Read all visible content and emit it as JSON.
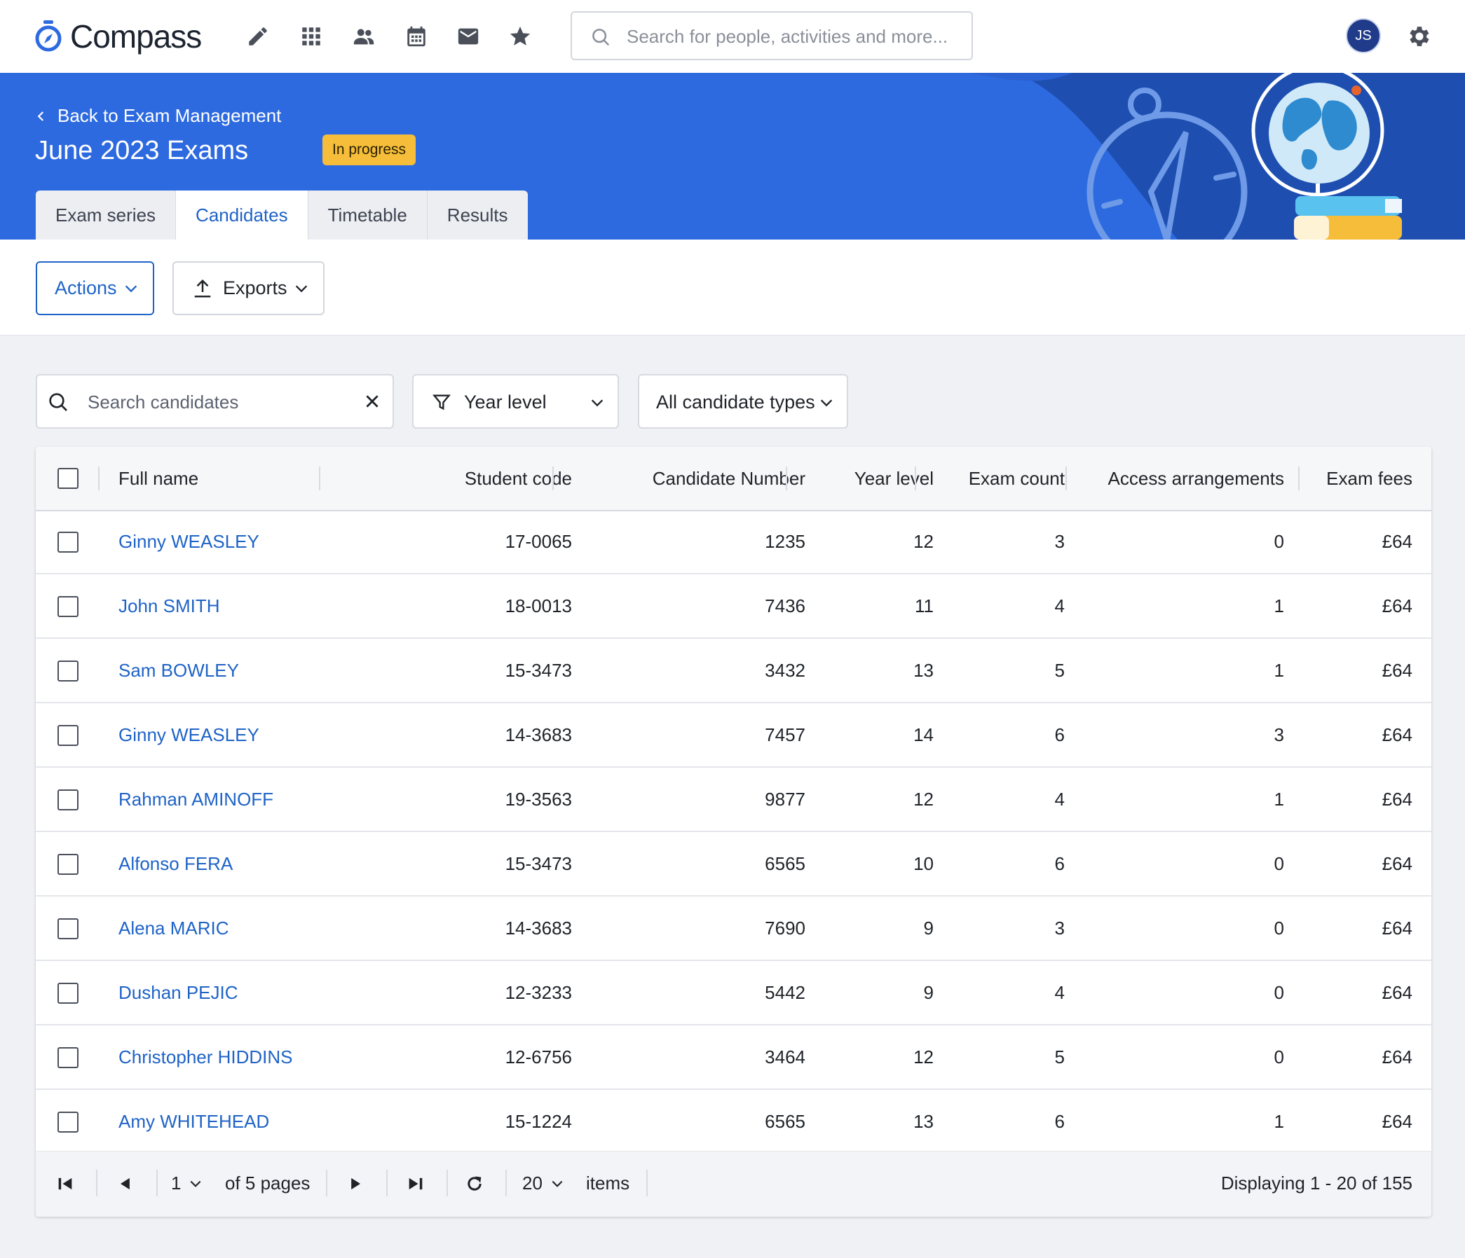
{
  "app": {
    "name": "Compass"
  },
  "top_nav": {
    "icons": [
      "pencil-icon",
      "apps-grid-icon",
      "people-icon",
      "calendar-icon",
      "mail-icon",
      "star-icon"
    ],
    "search_placeholder": "Search for people, activities and more...",
    "user_initials": "JS"
  },
  "header": {
    "back_label": "Back to Exam Management",
    "title": "June 2023 Exams",
    "status": "In progress",
    "tabs": [
      "Exam series",
      "Candidates",
      "Timetable",
      "Results"
    ],
    "active_tab": "Candidates"
  },
  "toolbar": {
    "actions_label": "Actions",
    "exports_label": "Exports"
  },
  "filters": {
    "search_placeholder": "Search candidates",
    "year_level_label": "Year level",
    "candidate_types_label": "All candidate types"
  },
  "table": {
    "columns": [
      "Full name",
      "Student code",
      "Candidate Number",
      "Year level",
      "Exam count",
      "Access arrangements",
      "Exam fees"
    ],
    "rows": [
      {
        "name": "Ginny WEASLEY",
        "code": "17-0065",
        "cand": "1235",
        "year": "12",
        "count": "3",
        "access": "0",
        "fee": "£64"
      },
      {
        "name": "John SMITH",
        "code": "18-0013",
        "cand": "7436",
        "year": "11",
        "count": "4",
        "access": "1",
        "fee": "£64"
      },
      {
        "name": "Sam BOWLEY",
        "code": "15-3473",
        "cand": "3432",
        "year": "13",
        "count": "5",
        "access": "1",
        "fee": "£64"
      },
      {
        "name": "Ginny WEASLEY",
        "code": "14-3683",
        "cand": "7457",
        "year": "14",
        "count": "6",
        "access": "3",
        "fee": "£64"
      },
      {
        "name": "Rahman AMINOFF",
        "code": "19-3563",
        "cand": "9877",
        "year": "12",
        "count": "4",
        "access": "1",
        "fee": "£64"
      },
      {
        "name": "Alfonso FERA",
        "code": "15-3473",
        "cand": "6565",
        "year": "10",
        "count": "6",
        "access": "0",
        "fee": "£64"
      },
      {
        "name": "Alena MARIC",
        "code": "14-3683",
        "cand": "7690",
        "year": "9",
        "count": "3",
        "access": "0",
        "fee": "£64"
      },
      {
        "name": "Dushan PEJIC",
        "code": "12-3233",
        "cand": "5442",
        "year": "9",
        "count": "4",
        "access": "0",
        "fee": "£64"
      },
      {
        "name": "Christopher HIDDINS",
        "code": "12-6756",
        "cand": "3464",
        "year": "12",
        "count": "5",
        "access": "0",
        "fee": "£64"
      },
      {
        "name": "Amy WHITEHEAD",
        "code": "15-1224",
        "cand": "6565",
        "year": "13",
        "count": "6",
        "access": "1",
        "fee": "£64"
      }
    ]
  },
  "pagination": {
    "current_page": "1",
    "of_pages": "of 5 pages",
    "page_size": "20",
    "items_label": "items",
    "summary": "Displaying 1 - 20 of 155"
  },
  "colors": {
    "brand_blue": "#2d6ae0",
    "link_blue": "#1f63c7",
    "badge_yellow": "#f5bd3a"
  }
}
